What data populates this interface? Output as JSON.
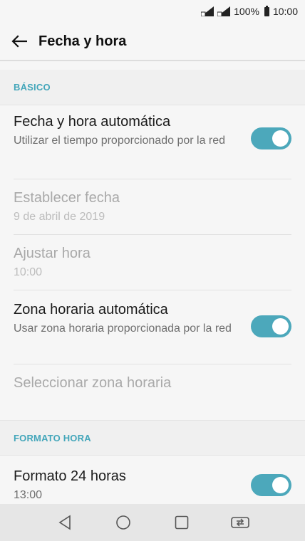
{
  "status_bar": {
    "battery": "100%",
    "time": "10:00"
  },
  "app_bar": {
    "title": "Fecha y hora"
  },
  "sections": {
    "basic": {
      "header": "BÁSICO",
      "auto_datetime": {
        "title": "Fecha y hora automática",
        "subtitle": "Utilizar el tiempo proporcionado por la red",
        "enabled": true
      },
      "set_date": {
        "title": "Establecer fecha",
        "subtitle": "9 de abril de 2019"
      },
      "set_time": {
        "title": "Ajustar hora",
        "subtitle": "10:00"
      },
      "auto_timezone": {
        "title": "Zona horaria automática",
        "subtitle": "Usar zona horaria proporcionada por la red",
        "enabled": true
      },
      "select_timezone": {
        "title": "Seleccionar zona horaria"
      }
    },
    "time_format": {
      "header": "FORMATO HORA",
      "format_24": {
        "title": "Formato 24 horas",
        "subtitle": "13:00",
        "enabled": true
      }
    }
  },
  "colors": {
    "accent": "#4ca8bb",
    "header_text": "#43a6ba"
  }
}
